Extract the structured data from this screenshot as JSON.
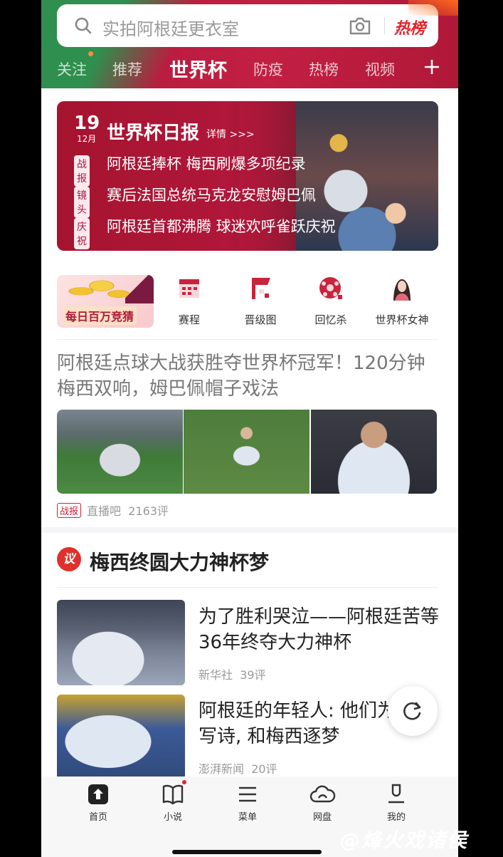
{
  "search": {
    "placeholder": "实拍阿根廷更衣室",
    "hot_label": "热榜"
  },
  "tabs": [
    {
      "label": "关注"
    },
    {
      "label": "推荐"
    },
    {
      "label": "世界杯",
      "active": true
    },
    {
      "label": "防疫"
    },
    {
      "label": "热榜"
    },
    {
      "label": "视频"
    }
  ],
  "banner": {
    "day": "19",
    "month": "12月",
    "title": "世界杯日报",
    "more": "详情 >>>",
    "items": [
      {
        "tag": "战报",
        "text": "阿根廷捧杯 梅西刷爆多项纪录"
      },
      {
        "tag": "镜头",
        "text": "赛后法国总统马克龙安慰姆巴佩"
      },
      {
        "tag": "庆祝",
        "text": "阿根廷首都沸腾 球迷欢呼雀跃庆祝"
      }
    ]
  },
  "promo": {
    "label": "每日百万竞猜"
  },
  "quick_icons": [
    {
      "label": "赛程",
      "icon": "calendar-icon"
    },
    {
      "label": "晋级图",
      "icon": "bracket-icon"
    },
    {
      "label": "回忆杀",
      "icon": "football-icon"
    },
    {
      "label": "世界杯女神",
      "icon": "goddess-avatar-icon"
    }
  ],
  "headline": {
    "title": "阿根廷点球大战获胜夺世界杯冠军！120分钟梅西双响，姆巴佩帽子戏法",
    "tag": "战报",
    "source": "直播吧",
    "comments": "2163评"
  },
  "topic": {
    "icon_text": "议",
    "title": "梅西终圆大力神杯梦"
  },
  "news": [
    {
      "title": "为了胜利哭泣——阿根廷苦等36年终夺大力神杯",
      "source": "新华社",
      "comments": "39评"
    },
    {
      "title": "阿根廷的年轻人: 他们为梅西写诗, 和梅西逐梦",
      "source": "澎湃新闻",
      "comments": "20评"
    }
  ],
  "bottom_nav": [
    {
      "label": "首页",
      "icon": "home-icon"
    },
    {
      "label": "小说",
      "icon": "book-icon"
    },
    {
      "label": "菜单",
      "icon": "menu-icon"
    },
    {
      "label": "网盘",
      "icon": "cloud-icon"
    },
    {
      "label": "我的",
      "icon": "profile-icon"
    }
  ],
  "watermark": "@烽火戏诸侯",
  "colors": {
    "brand_red": "#c21f43",
    "hot_red": "#e4222b"
  }
}
